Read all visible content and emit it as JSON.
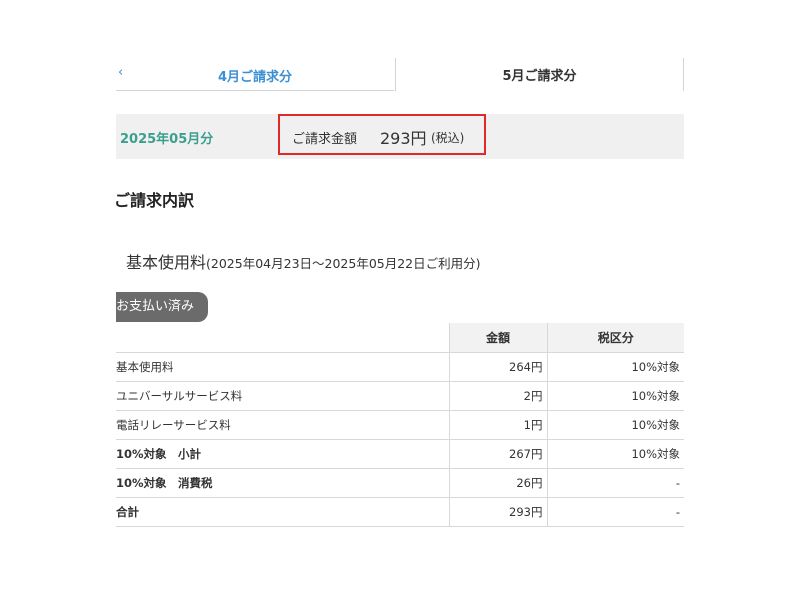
{
  "tabs": {
    "prev_chevron": "‹",
    "prev_label": "4月ご請求分",
    "current_label": "5月ご請求分"
  },
  "summary": {
    "month": "2025年05月分",
    "amount_label": "ご請求金額",
    "amount_value": "293円",
    "tax_note": "(税込)"
  },
  "section": {
    "title": "ご請求内訳"
  },
  "item": {
    "name": "基本使用料",
    "period": "(2025年04月23日〜2025年05月22日ご利用分)",
    "status_badge": "お支払い済み"
  },
  "table": {
    "headers": [
      "",
      "金額",
      "税区分"
    ],
    "rows": [
      {
        "name": "基本使用料",
        "amount": "264円",
        "tax": "10%対象",
        "bold": false
      },
      {
        "name": "ユニバーサルサービス料",
        "amount": "2円",
        "tax": "10%対象",
        "bold": false
      },
      {
        "name": "電話リレーサービス料",
        "amount": "1円",
        "tax": "10%対象",
        "bold": false
      },
      {
        "name": "10%対象　小計",
        "amount": "267円",
        "tax": "10%対象",
        "bold": true
      },
      {
        "name": "10%対象　消費税",
        "amount": "26円",
        "tax": "-",
        "bold": true
      },
      {
        "name": "合計",
        "amount": "293円",
        "tax": "-",
        "bold": true
      }
    ]
  },
  "colors": {
    "tab_link": "#3b8fd3",
    "month_text": "#3a9f8c",
    "highlight_border": "#e02a2a",
    "badge_bg": "#6b6b6b"
  }
}
